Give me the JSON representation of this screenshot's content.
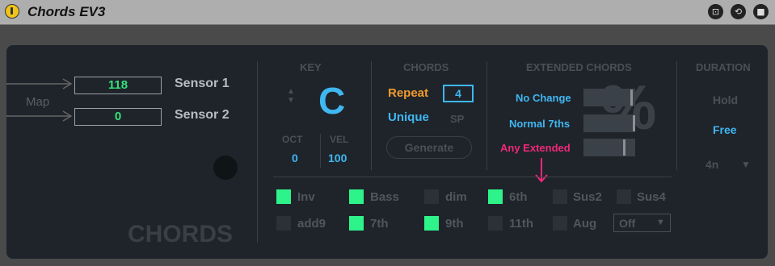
{
  "window": {
    "title": "Chords EV3"
  },
  "map": {
    "label": "Map",
    "sensor1_value": "118",
    "sensor2_value": "0",
    "sensor1_label": "Sensor 1",
    "sensor2_label": "Sensor 2"
  },
  "brand": "CHORDS",
  "key": {
    "header": "KEY",
    "note": "C",
    "oct_label": "OCT",
    "oct_value": "0",
    "vel_label": "VEL",
    "vel_value": "100"
  },
  "chords": {
    "header": "CHORDS",
    "repeat_label": "Repeat",
    "repeat_value": "4",
    "unique_label": "Unique",
    "sp_label": "SP",
    "generate_label": "Generate"
  },
  "extended": {
    "header": "EXTENDED CHORDS",
    "options": [
      {
        "label": "No Change",
        "level": 0.95
      },
      {
        "label": "Normal 7ths",
        "level": 1.0
      },
      {
        "label": "Any Extended",
        "level": 0.8
      }
    ],
    "percent_symbol": "%"
  },
  "duration": {
    "header": "DURATION",
    "hold": "Hold",
    "free": "Free",
    "note_value": "4n"
  },
  "toggles": [
    {
      "label": "Inv",
      "on": true
    },
    {
      "label": "Bass",
      "on": true
    },
    {
      "label": "dim",
      "on": false
    },
    {
      "label": "6th",
      "on": true
    },
    {
      "label": "Sus2",
      "on": false
    },
    {
      "label": "Sus4",
      "on": false
    },
    {
      "label": "add9",
      "on": false
    },
    {
      "label": "7th",
      "on": true
    },
    {
      "label": "9th",
      "on": true
    },
    {
      "label": "11th",
      "on": false
    },
    {
      "label": "Aug",
      "on": false
    }
  ],
  "off_select": {
    "value": "Off"
  },
  "colors": {
    "accent_green": "#2ef28a",
    "accent_blue": "#3fb7f0",
    "accent_orange": "#f29a2e",
    "accent_pink": "#f0287a",
    "panel": "#1f242b"
  }
}
